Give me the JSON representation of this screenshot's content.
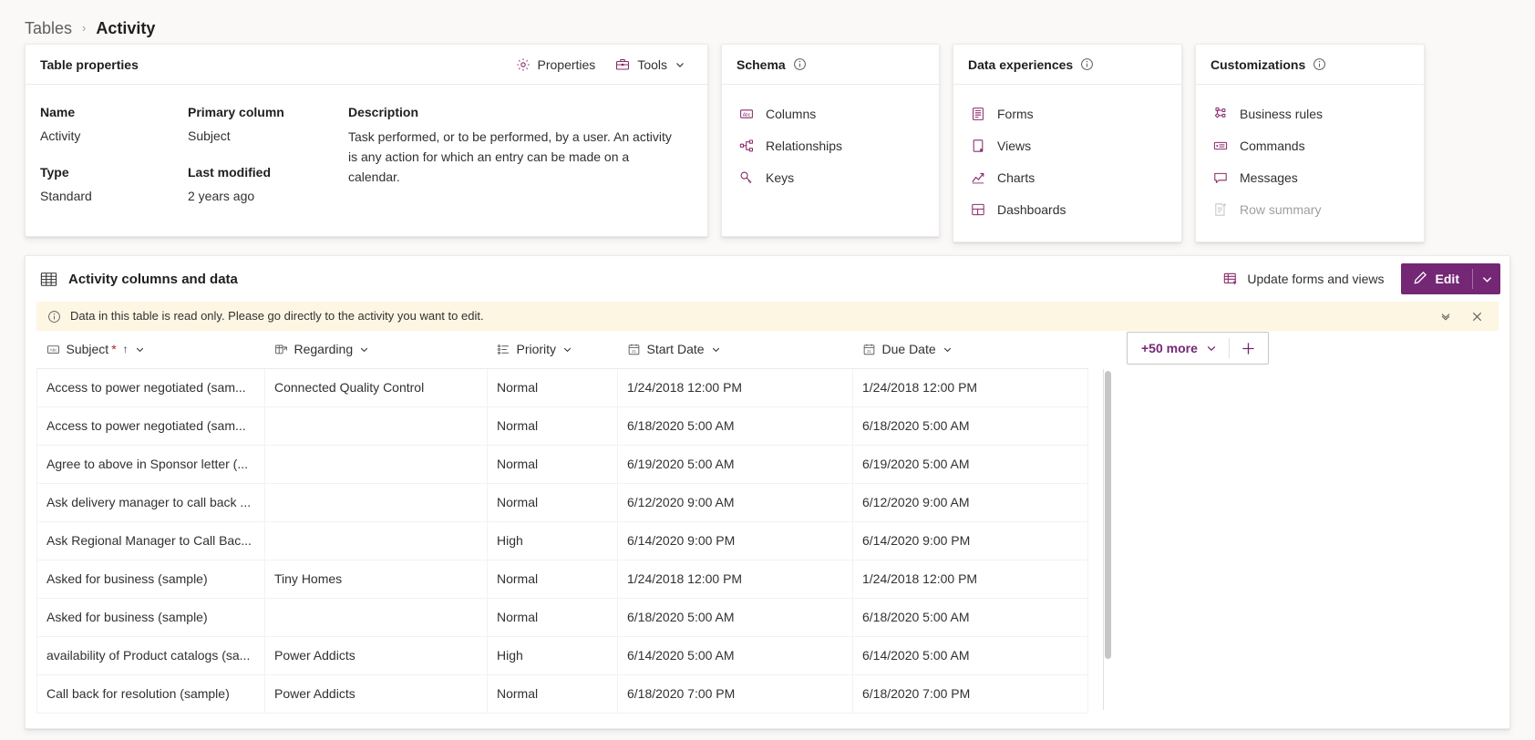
{
  "breadcrumb": {
    "parent": "Tables",
    "separator": "›",
    "current": "Activity"
  },
  "table_properties": {
    "title": "Table properties",
    "actions": {
      "properties": "Properties",
      "tools": "Tools"
    },
    "fields": {
      "name_label": "Name",
      "name_value": "Activity",
      "type_label": "Type",
      "type_value": "Standard",
      "primary_label": "Primary column",
      "primary_value": "Subject",
      "modified_label": "Last modified",
      "modified_value": "2 years ago",
      "description_label": "Description",
      "description_value": "Task performed, or to be performed, by a user. An activity is any action for which an entry can be made on a calendar."
    }
  },
  "schema": {
    "title": "Schema",
    "items": [
      {
        "label": "Columns",
        "icon": "abc-icon",
        "disabled": false
      },
      {
        "label": "Relationships",
        "icon": "relationships-icon",
        "disabled": false
      },
      {
        "label": "Keys",
        "icon": "key-icon",
        "disabled": false
      }
    ]
  },
  "data_experiences": {
    "title": "Data experiences",
    "items": [
      {
        "label": "Forms",
        "icon": "form-icon",
        "disabled": false
      },
      {
        "label": "Views",
        "icon": "view-icon",
        "disabled": false
      },
      {
        "label": "Charts",
        "icon": "chart-icon",
        "disabled": false
      },
      {
        "label": "Dashboards",
        "icon": "dashboard-icon",
        "disabled": false
      }
    ]
  },
  "customizations": {
    "title": "Customizations",
    "items": [
      {
        "label": "Business rules",
        "icon": "business-rules-icon",
        "disabled": false
      },
      {
        "label": "Commands",
        "icon": "commands-icon",
        "disabled": false
      },
      {
        "label": "Messages",
        "icon": "messages-icon",
        "disabled": false
      },
      {
        "label": "Row summary",
        "icon": "row-summary-icon",
        "disabled": true
      }
    ]
  },
  "grid_panel": {
    "title": "Activity columns and data",
    "update_forms_label": "Update forms and views",
    "edit_label": "Edit",
    "more_columns_label": "+50 more",
    "banner": {
      "text": "Data in this table is read only. Please go directly to the activity you want to edit."
    },
    "columns": [
      {
        "label": "Subject",
        "icon": "abc-icon",
        "required": true,
        "sorted": "asc",
        "sort_glyph": "↑"
      },
      {
        "label": "Regarding",
        "icon": "lookup-icon",
        "required": false,
        "sorted": "none",
        "sort_glyph": ""
      },
      {
        "label": "Priority",
        "icon": "choice-icon",
        "required": false,
        "sorted": "none",
        "sort_glyph": ""
      },
      {
        "label": "Start Date",
        "icon": "calendar-icon",
        "required": false,
        "sorted": "none",
        "sort_glyph": ""
      },
      {
        "label": "Due Date",
        "icon": "calendar-icon",
        "required": false,
        "sorted": "none",
        "sort_glyph": ""
      }
    ],
    "rows": [
      {
        "subject": "Access to power negotiated (sam...",
        "regarding": "Connected Quality Control",
        "priority": "Normal",
        "start_date": "1/24/2018 12:00 PM",
        "due_date": "1/24/2018 12:00 PM"
      },
      {
        "subject": "Access to power negotiated (sam...",
        "regarding": "",
        "priority": "Normal",
        "start_date": "6/18/2020 5:00 AM",
        "due_date": "6/18/2020 5:00 AM"
      },
      {
        "subject": "Agree to above in Sponsor letter (...",
        "regarding": "",
        "priority": "Normal",
        "start_date": "6/19/2020 5:00 AM",
        "due_date": "6/19/2020 5:00 AM"
      },
      {
        "subject": "Ask delivery manager to call back ...",
        "regarding": "",
        "priority": "Normal",
        "start_date": "6/12/2020 9:00 AM",
        "due_date": "6/12/2020 9:00 AM"
      },
      {
        "subject": "Ask Regional Manager to Call Bac...",
        "regarding": "",
        "priority": "High",
        "start_date": "6/14/2020 9:00 PM",
        "due_date": "6/14/2020 9:00 PM"
      },
      {
        "subject": "Asked for business (sample)",
        "regarding": "Tiny Homes",
        "priority": "Normal",
        "start_date": "1/24/2018 12:00 PM",
        "due_date": "1/24/2018 12:00 PM"
      },
      {
        "subject": "Asked for business (sample)",
        "regarding": "",
        "priority": "Normal",
        "start_date": "6/18/2020 5:00 AM",
        "due_date": "6/18/2020 5:00 AM"
      },
      {
        "subject": "availability of Product catalogs (sa...",
        "regarding": "Power Addicts",
        "priority": "High",
        "start_date": "6/14/2020 5:00 AM",
        "due_date": "6/14/2020 5:00 AM"
      },
      {
        "subject": "Call back for resolution (sample)",
        "regarding": "Power Addicts",
        "priority": "Normal",
        "start_date": "6/18/2020 7:00 PM",
        "due_date": "6/18/2020 7:00 PM"
      }
    ]
  },
  "colors": {
    "accent": "#742774",
    "icon_accent": "#8a2a6b",
    "banner_bg": "#fdf6e3",
    "required_asterisk": "#a4262c",
    "page_bg": "#faf9f8"
  }
}
